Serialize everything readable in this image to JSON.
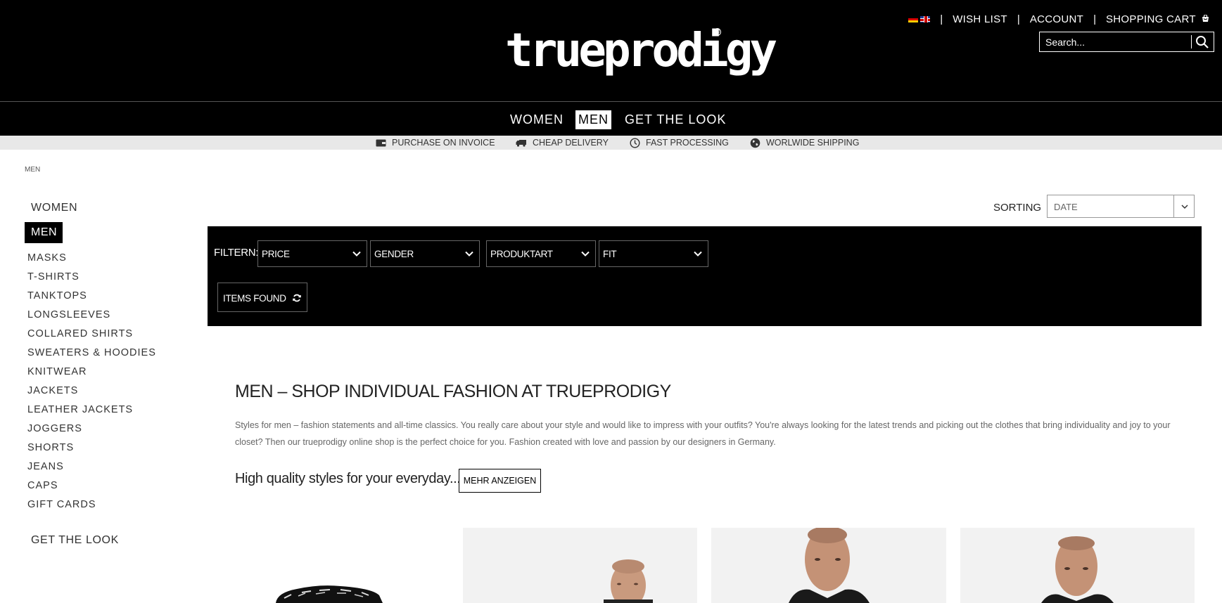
{
  "header": {
    "logo_text": "trueprodigy",
    "top_links": {
      "wishlist": "WISH LIST",
      "account": "ACCOUNT",
      "cart": "SHOPPING CART",
      "separator": "|"
    },
    "search": {
      "placeholder": "Search..."
    }
  },
  "mainnav": {
    "items": [
      {
        "label": "WOMEN"
      },
      {
        "label": "MEN"
      },
      {
        "label": "GET THE LOOK"
      }
    ]
  },
  "benefits": [
    {
      "label": "PURCHASE ON INVOICE",
      "icon": "wallet-icon"
    },
    {
      "label": "CHEAP DELIVERY",
      "icon": "truck-icon"
    },
    {
      "label": "FAST PROCESSING",
      "icon": "clock-icon"
    },
    {
      "label": "WORLWIDE SHIPPING",
      "icon": "globe-icon"
    }
  ],
  "breadcrumb": "MEN",
  "sidebar": {
    "women": "WOMEN",
    "men": "MEN",
    "categories": [
      "MASKS",
      "T-SHIRTS",
      "TANKTOPS",
      "LONGSLEEVES",
      "COLLARED SHIRTS",
      "SWEATERS & HOODIES",
      "KNITWEAR",
      "JACKETS",
      "LEATHER JACKETS",
      "JOGGERS",
      "SHORTS",
      "JEANS",
      "CAPS",
      "GIFT CARDS"
    ],
    "get_the_look": "GET THE LOOK"
  },
  "sorting": {
    "label": "SORTING",
    "value": "DATE"
  },
  "filters": {
    "label": "FILTERN:",
    "selects": [
      "PRICE",
      "GENDER",
      "PRODUKTART",
      "FIT"
    ],
    "items_found": "ITEMS FOUND"
  },
  "content": {
    "title": "MEN – SHOP INDIVIDUAL FASHION AT TRUEPRODIGY",
    "intro": "Styles for men – fashion statements and all-time classics. You really care about your style and would like to impress with your outfits? You're always looking for the latest trends and picking out the clothes that bring individuality and joy to your closet? Then our trueprodigy online shop is the perfect choice for you. Fashion created with love and passion by our designers in Germany.",
    "tagline": "High quality styles for your everyday...",
    "more_button": "MEHR ANZEIGEN"
  },
  "colors": {
    "header_bg": "#000000",
    "benefits_bg": "#e8e8e8",
    "accent": "#000000"
  }
}
